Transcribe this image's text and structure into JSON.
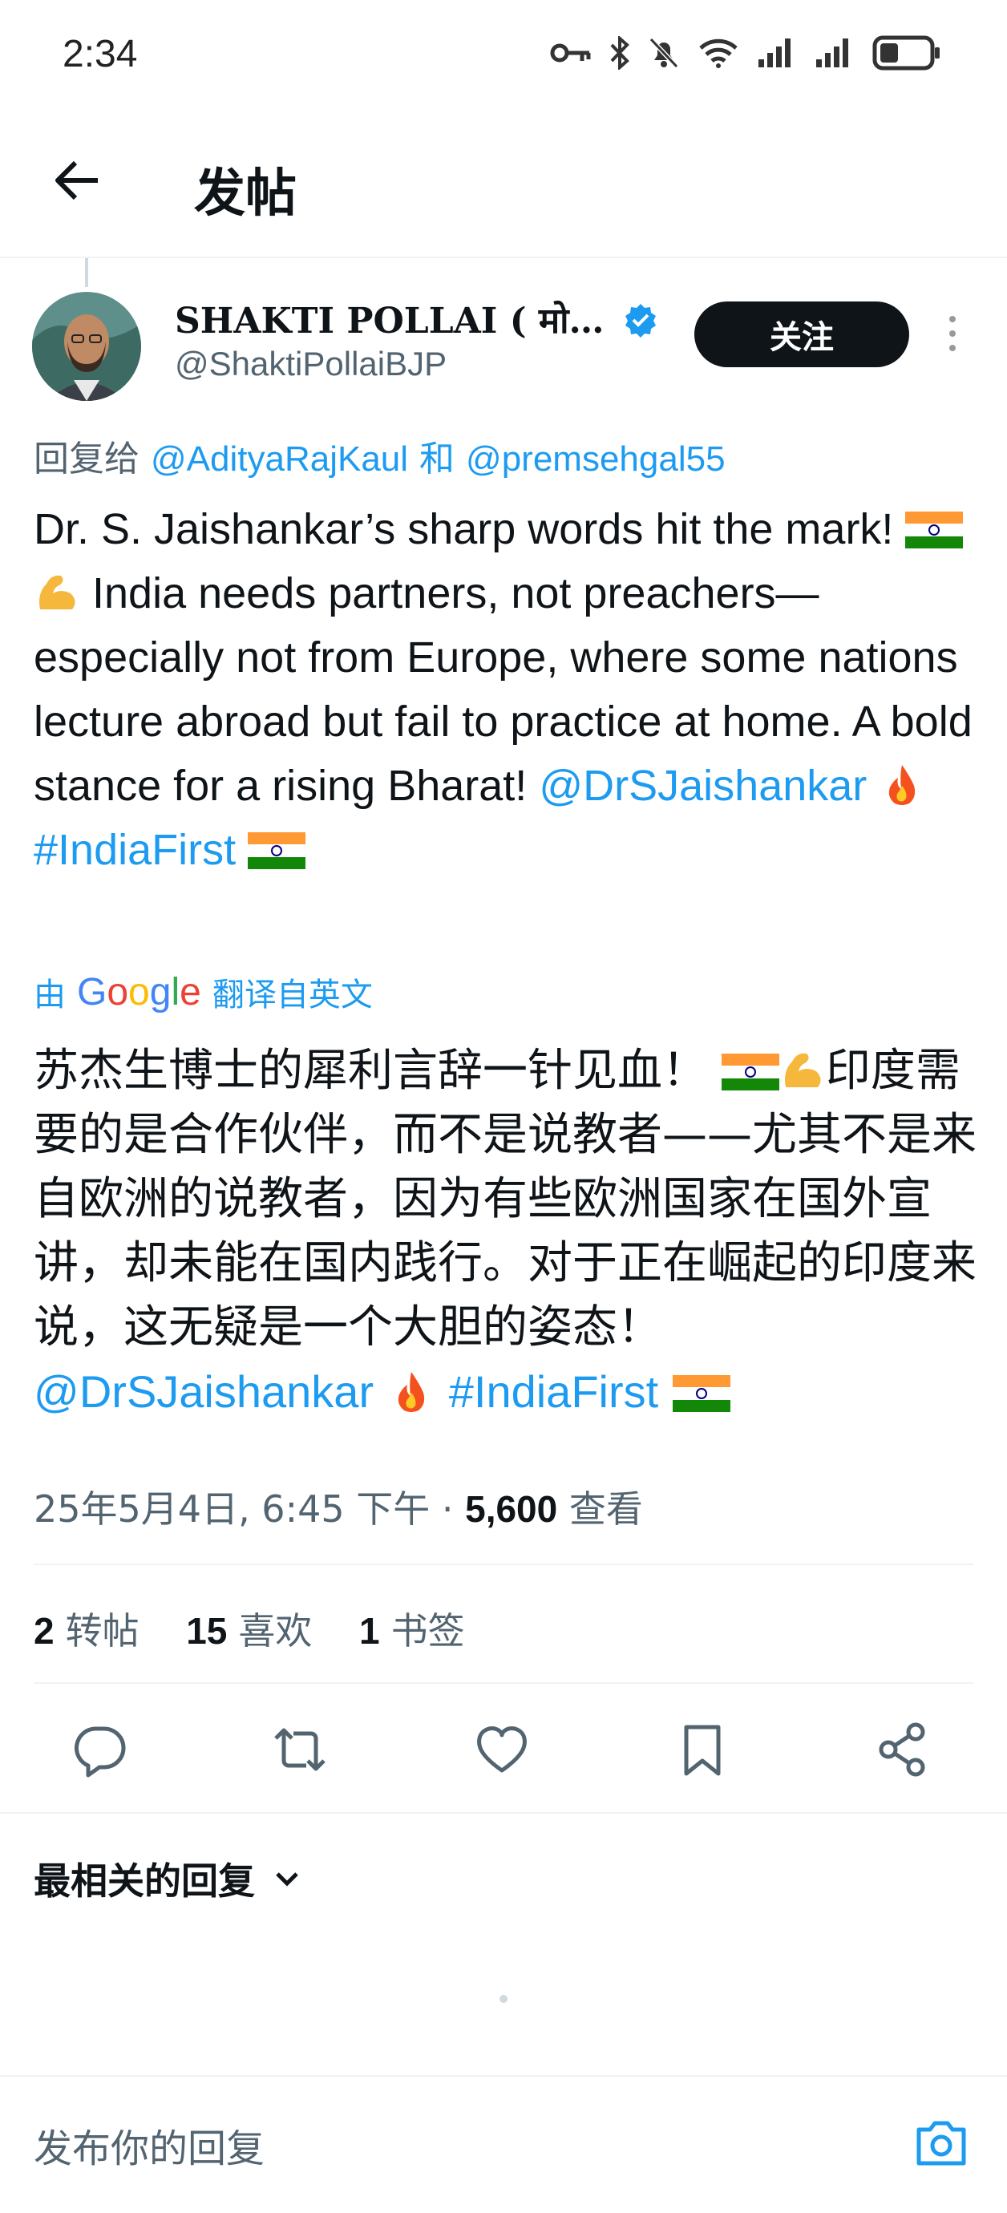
{
  "status_bar": {
    "time": "2:34"
  },
  "header": {
    "title": "发帖"
  },
  "post": {
    "author_name": "SHAKTI POLLAI ( मो…",
    "author_handle": "@ShaktiPollaiBJP",
    "follow_label": "关注",
    "reply_prefix": "回复给",
    "reply_user1": "@AdityaRajKaul",
    "reply_and": "和",
    "reply_user2": "@premsehgal55",
    "text_en_1": "Dr. S. Jaishankar’s sharp words hit the mark!",
    "text_en_2": "India needs partners, not preachers—especially not from Europe, where some nations lecture abroad but fail to practice at home. A bold stance for a rising Bharat!",
    "text_en_mention": "@DrSJaishankar",
    "text_en_hashtag": "#IndiaFirst",
    "translate_prefix": "由",
    "translate_brand": "Google",
    "translate_suffix": "翻译自英文",
    "text_zh_1": "苏杰生博士的犀利言辞一针见血！",
    "text_zh_2": "印度需要的是合作伙伴，而不是说教者——尤其不是来自欧洲的说教者，因为有些欧洲国家在国外宣讲，却未能在国内践行。对于正在崛起的印度来说，这无疑是一个大胆的姿态！",
    "text_zh_mention": "@DrSJaishankar",
    "text_zh_hashtag": "#IndiaFirst",
    "meta_datetime": "25年5月4日, 6:45 下午 ·",
    "meta_views": "5,600",
    "meta_views_label": "查看",
    "reposts_count": "2",
    "reposts_label": "转帖",
    "likes_count": "15",
    "likes_label": "喜欢",
    "bookmarks_count": "1",
    "bookmarks_label": "书签"
  },
  "replies": {
    "sort_label": "最相关的回复"
  },
  "composer": {
    "placeholder": "发布你的回复"
  },
  "colors": {
    "accent": "#1d9bf0",
    "text": "#0f1419",
    "secondary": "#536471",
    "verified": "#1d9bf0"
  }
}
